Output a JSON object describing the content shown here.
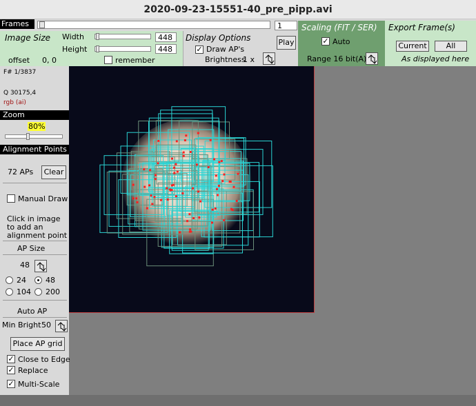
{
  "window": {
    "title": "2020-09-23-15551-40_pre_pipp.avi"
  },
  "frames": {
    "label": "Frames",
    "value": "1"
  },
  "image_size": {
    "title": "Image Size",
    "width_label": "Width",
    "width_value": "448",
    "height_label": "Height",
    "height_value": "448",
    "offset_label": "offset",
    "offset_value": "0, 0",
    "remember_label": "remember"
  },
  "display_options": {
    "title": "Display Options",
    "draw_aps_label": "Draw AP's",
    "brightness_label": "Brightness",
    "brightness_value": "1 x",
    "play_label": "Play"
  },
  "scaling": {
    "title": "Scaling (FIT / SER)",
    "auto_label": "Auto",
    "range_label": "Range 16 bit(A)"
  },
  "export": {
    "title": "Export Frame(s)",
    "current_label": "Current",
    "all_label": "All",
    "as_displayed": "As displayed here"
  },
  "info": {
    "frame_number": "F# 1/3837",
    "quality": "Q  30175,4",
    "mode": "rgb (ai)"
  },
  "zoom": {
    "label": "Zoom",
    "value": "80%"
  },
  "alignment": {
    "label": "Alignment Points",
    "count": "72 APs",
    "clear_label": "Clear",
    "manual_draw_label": "Manual Draw",
    "hint_line1": "Click in image",
    "hint_line2": "to add an",
    "hint_line3": "alignment point",
    "ap_size_label": "AP Size",
    "ap_size_value": "48",
    "sizes": [
      "24",
      "48",
      "104",
      "200"
    ],
    "selected_size": "48",
    "auto_ap_label": "Auto AP",
    "min_bright_label": "Min Bright",
    "min_bright_value": "50",
    "place_grid_label": "Place AP grid",
    "close_to_edge_label": "Close to Edge",
    "replace_label": "Replace",
    "multiscale_label": "Multi-Scale"
  },
  "colors": {
    "ap_box": "#2ad4d4",
    "ap_point": "#ff2020",
    "image_bg": "#080a1a",
    "panel_green": "#c8e6c8"
  }
}
